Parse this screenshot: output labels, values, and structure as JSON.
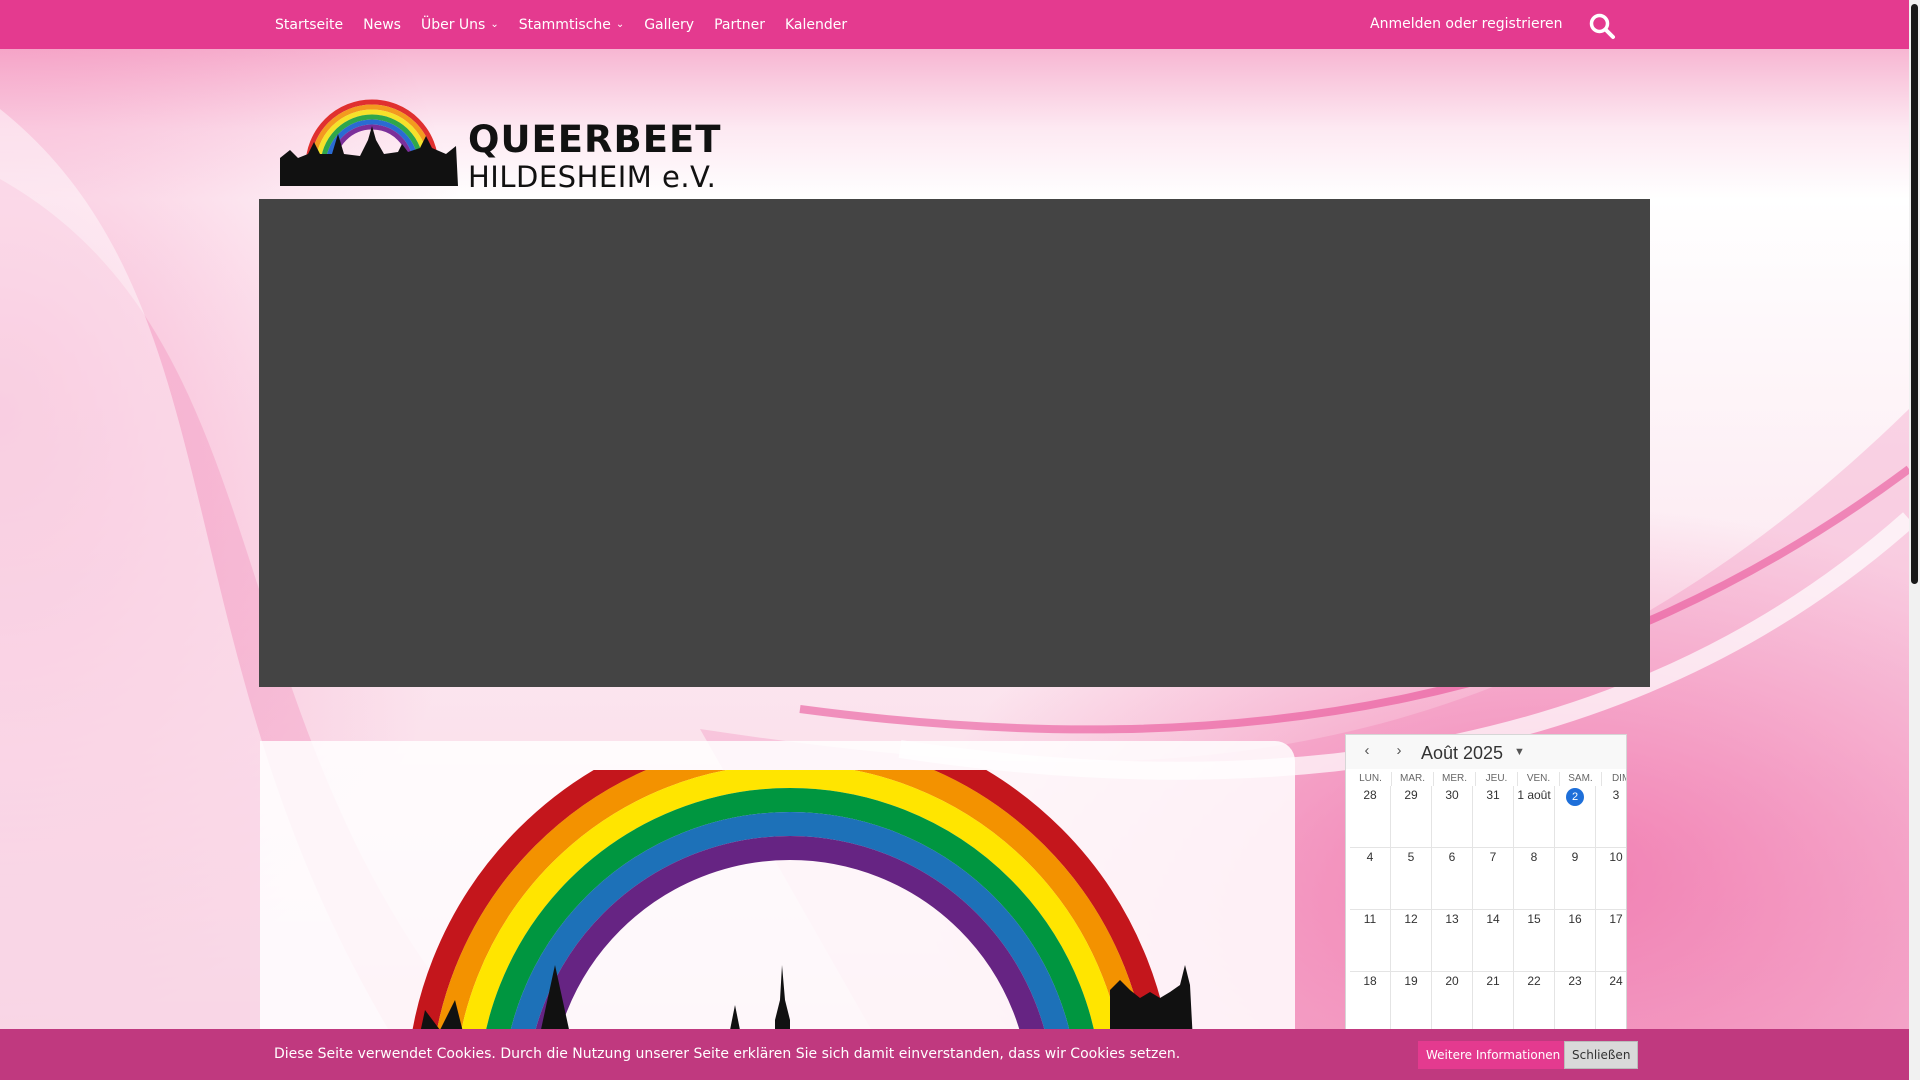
{
  "nav": {
    "items": [
      {
        "label": "Startseite",
        "dropdown": false
      },
      {
        "label": "News",
        "dropdown": false
      },
      {
        "label": "Über Uns",
        "dropdown": true
      },
      {
        "label": "Stammtische",
        "dropdown": true
      },
      {
        "label": "Gallery",
        "dropdown": false
      },
      {
        "label": "Partner",
        "dropdown": false
      },
      {
        "label": "Kalender",
        "dropdown": false
      }
    ],
    "login_label": "Anmelden oder registrieren",
    "search_icon": "search-icon"
  },
  "logo": {
    "title": "QUEERBEET",
    "subtitle": "HILDESHEIM e.V."
  },
  "calendar": {
    "title": "Août 2025",
    "weekdays": [
      "LUN.",
      "MAR.",
      "MER.",
      "JEU.",
      "VEN.",
      "SAM.",
      "DIM."
    ],
    "weeks": [
      [
        "28",
        "29",
        "30",
        "31",
        "1 août",
        "2",
        "3"
      ],
      [
        "4",
        "5",
        "6",
        "7",
        "8",
        "9",
        "10"
      ],
      [
        "11",
        "12",
        "13",
        "14",
        "15",
        "16",
        "17"
      ],
      [
        "18",
        "19",
        "20",
        "21",
        "22",
        "23",
        "24"
      ]
    ],
    "today": "2"
  },
  "cookie": {
    "text": "Diese Seite verwendet Cookies. Durch die Nutzung unserer Seite erklären Sie sich damit einverstanden, dass wir Cookies setzen.",
    "more_label": "Weitere Informationen",
    "close_label": "Schließen"
  },
  "colors": {
    "brand_pink": "#e43a8f",
    "cookie_bar": "#c0397f",
    "slider_bg": "#444444",
    "today_blue": "#1e6fd9"
  }
}
